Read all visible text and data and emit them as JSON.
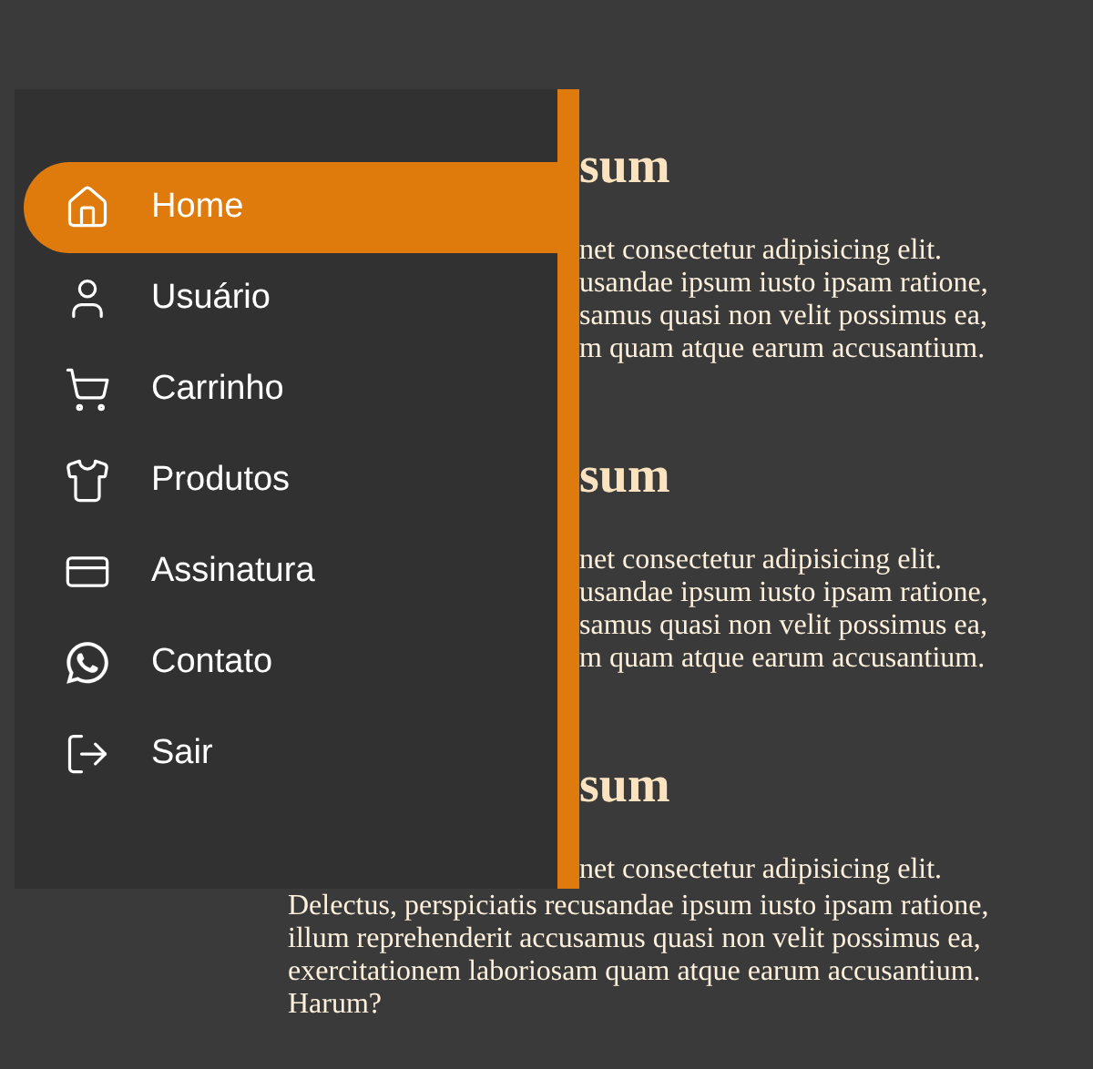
{
  "sidebar": {
    "items": [
      {
        "label": "Home",
        "selected": true
      },
      {
        "label": "Usuário",
        "selected": false
      },
      {
        "label": "Carrinho",
        "selected": false
      },
      {
        "label": "Produtos",
        "selected": false
      },
      {
        "label": "Assinatura",
        "selected": false
      },
      {
        "label": "Contato",
        "selected": false
      },
      {
        "label": "Sair",
        "selected": false
      }
    ]
  },
  "content": {
    "sections": [
      {
        "heading": "sum",
        "cut_lines": [
          "net consectetur adipisicing elit.",
          "usandae ipsum iusto ipsam ratione,",
          "samus quasi non velit possimus ea,",
          "m quam atque earum accusantium."
        ]
      },
      {
        "heading": "sum",
        "cut_lines": [
          "net consectetur adipisicing elit.",
          "usandae ipsum iusto ipsam ratione,",
          "samus quasi non velit possimus ea,",
          "m quam atque earum accusantium."
        ]
      },
      {
        "heading": "sum",
        "cut_lines": [
          "net consectetur adipisicing elit."
        ],
        "lines": [
          "Delectus, perspiciatis recusandae ipsum iusto ipsam ratione,",
          "illum reprehenderit accusamus quasi non velit possimus ea,",
          "exercitationem laboriosam quam atque earum accusantium.",
          "Harum?"
        ]
      }
    ]
  }
}
